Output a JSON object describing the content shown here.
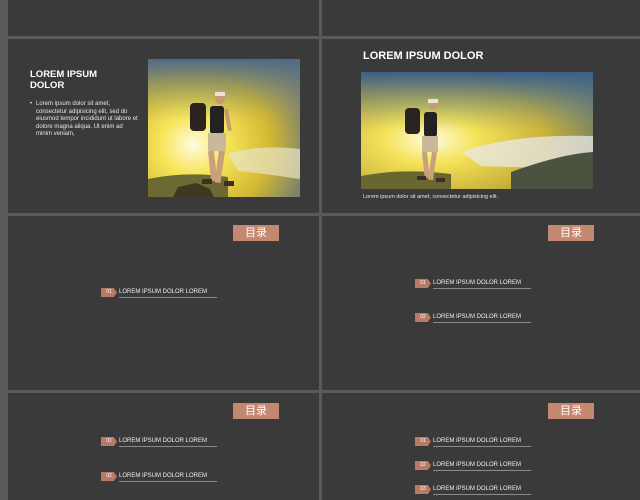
{
  "colors": {
    "slide_bg": "#3a3a3a",
    "gap": "#5a5a5a",
    "accent": "#c4876f",
    "number_tag": "#b87a66"
  },
  "slide_left_text": {
    "title_line1": "LOREM IPSUM",
    "title_line2": "DOLOR",
    "body": "Lorem ipsum dolor sit amet, consectetur adipisicing elit, sed do eiusmod tempor incididunt ut labore et dolore magna aliqua. Ut enim ad minim veniam,"
  },
  "slide_right_photo": {
    "title": "LOREM IPSUM DOLOR",
    "caption": "Lorem ipsum dolor sit amet, consectetur adipisicing elit."
  },
  "toc": {
    "badge": "目录",
    "item_text": "LOREM IPSUM DOLOR LOREM",
    "numbers": [
      "01",
      "02",
      "03"
    ]
  }
}
